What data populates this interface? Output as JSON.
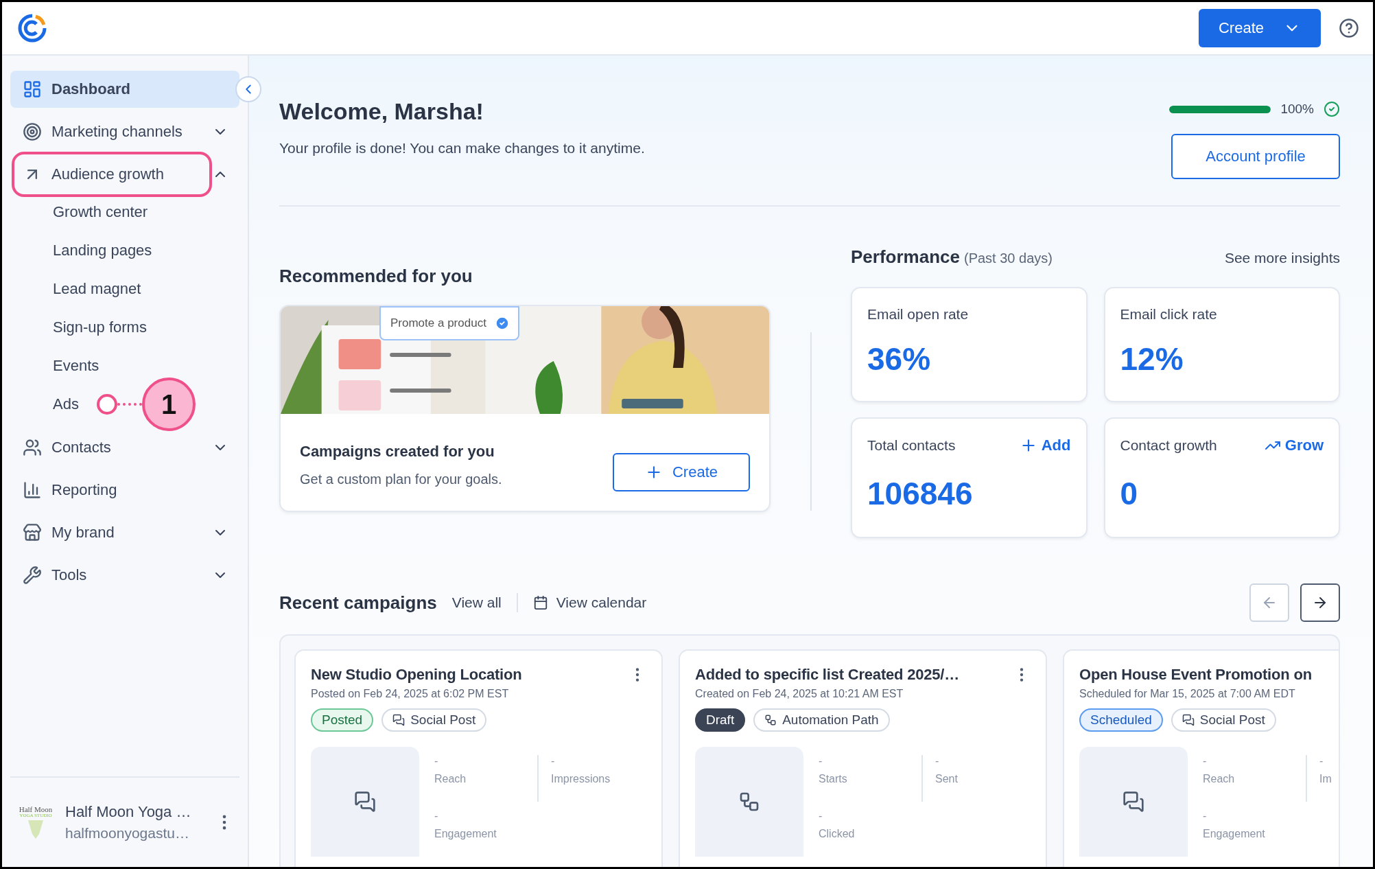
{
  "header": {
    "create_button": "Create"
  },
  "sidebar": {
    "items": [
      {
        "label": "Dashboard",
        "kind": "link",
        "selected": true,
        "highlighted": false
      },
      {
        "label": "Marketing channels",
        "kind": "group",
        "expanded": false,
        "selected": false,
        "highlighted": false
      },
      {
        "label": "Audience growth",
        "kind": "group",
        "expanded": true,
        "selected": false,
        "highlighted": true,
        "children": [
          {
            "label": "Growth center"
          },
          {
            "label": "Landing pages"
          },
          {
            "label": "Lead magnet"
          },
          {
            "label": "Sign-up forms"
          },
          {
            "label": "Events"
          },
          {
            "label": "Ads",
            "callout": "1"
          }
        ]
      },
      {
        "label": "Contacts",
        "kind": "group",
        "expanded": false,
        "selected": false,
        "highlighted": false
      },
      {
        "label": "Reporting",
        "kind": "link",
        "selected": false,
        "highlighted": false
      },
      {
        "label": "My brand",
        "kind": "group",
        "expanded": false,
        "selected": false,
        "highlighted": false
      },
      {
        "label": "Tools",
        "kind": "group",
        "expanded": false,
        "selected": false,
        "highlighted": false
      }
    ],
    "account": {
      "logo_lines": [
        "Half Moon",
        "YOGA STUDIO"
      ],
      "name": "Half Moon Yoga …",
      "email": "halfmoonyogastu…"
    }
  },
  "welcome": {
    "title": "Welcome, Marsha!",
    "text": "Your profile is done! You can make changes to it anytime.",
    "progress": {
      "level": 1,
      "reading": "100%",
      "complete": true
    },
    "button": "Account profile"
  },
  "recommended": {
    "title": "Recommended for you",
    "badge": "Promote a product",
    "card_title": "Campaigns created for you",
    "card_text": "Get a custom plan for your goals.",
    "button": "Create"
  },
  "performance": {
    "title": "Performance",
    "period": "(Past 30 days)",
    "link": "See more insights",
    "metrics": [
      {
        "label": "Email open rate",
        "value": "36%"
      },
      {
        "label": "Email click rate",
        "value": "12%"
      },
      {
        "label": "Total contacts",
        "value": "106846",
        "action": {
          "kind": "add",
          "label": "Add"
        }
      },
      {
        "label": "Contact growth",
        "value": "0",
        "action": {
          "kind": "grow",
          "label": "Grow"
        }
      }
    ]
  },
  "recent": {
    "title": "Recent campaigns",
    "view_all": "View all",
    "view_calendar": "View calendar",
    "previous_disabled": true,
    "next_disabled": false,
    "campaigns": [
      {
        "title": "New Studio Opening Location",
        "meta": "Posted on Feb 24, 2025 at 6:02 PM EST",
        "menu": true,
        "status": {
          "kind": "posted",
          "label": "Posted"
        },
        "type": {
          "kind": "social",
          "label": "Social Post"
        },
        "stats": [
          {
            "value": "-",
            "label": "Reach"
          },
          {
            "value": "-",
            "label": "Impressions"
          },
          {
            "value": "-",
            "label": "Engagement"
          }
        ]
      },
      {
        "title": "Added to specific list Created 2025/…",
        "meta": "Created on Feb 24, 2025 at 10:21 AM EST",
        "menu": true,
        "status": {
          "kind": "draft",
          "label": "Draft"
        },
        "type": {
          "kind": "automation",
          "label": "Automation Path"
        },
        "stats": [
          {
            "value": "-",
            "label": "Starts"
          },
          {
            "value": "-",
            "label": "Sent"
          },
          {
            "value": "-",
            "label": "Clicked"
          }
        ]
      },
      {
        "title": "Open House Event Promotion on",
        "meta": "Scheduled for Mar 15, 2025 at 7:00 AM EDT",
        "status": {
          "kind": "scheduled",
          "label": "Scheduled"
        },
        "type": {
          "kind": "social",
          "label": "Social Post"
        },
        "stats": [
          {
            "value": "-",
            "label": "Reach"
          },
          {
            "value": "-",
            "label": "Im"
          },
          {
            "value": "-",
            "label": "Engagement"
          }
        ]
      }
    ]
  }
}
